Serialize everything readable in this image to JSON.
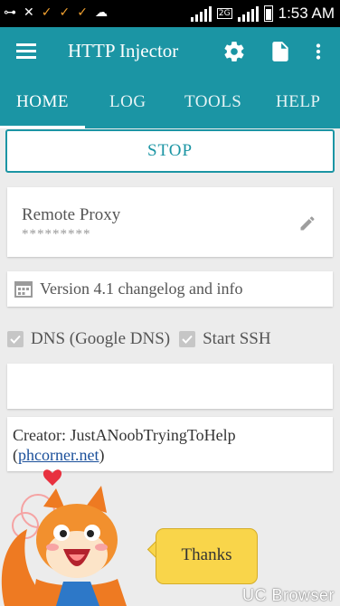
{
  "status_bar": {
    "time": "1:53 AM",
    "network_label": "2G"
  },
  "app_bar": {
    "title": "HTTP Injector",
    "icons": [
      "menu-icon",
      "gear-icon",
      "document-icon",
      "more-vert-icon"
    ]
  },
  "tabs": [
    {
      "label": "HOME",
      "active": true
    },
    {
      "label": "LOG",
      "active": false
    },
    {
      "label": "TOOLS",
      "active": false
    },
    {
      "label": "HELP",
      "active": false
    }
  ],
  "stop_button": {
    "label": "STOP"
  },
  "proxy": {
    "title": "Remote Proxy",
    "value": "*********"
  },
  "changelog": {
    "label": "Version 4.1 changelog and info"
  },
  "options": [
    {
      "label": "DNS (Google DNS)",
      "checked": true
    },
    {
      "label": "Start SSH",
      "checked": true
    }
  ],
  "creator": {
    "prefix": "Creator: JustANoobTryingToHelp",
    "open": "(",
    "link": "phcorner.net",
    "close": ")"
  },
  "promo": {
    "bubble_text": "Thanks",
    "watermark": "UC Browser"
  },
  "colors": {
    "primary": "#1b95a4",
    "background": "#ececec",
    "bubble": "#f9d54a"
  }
}
